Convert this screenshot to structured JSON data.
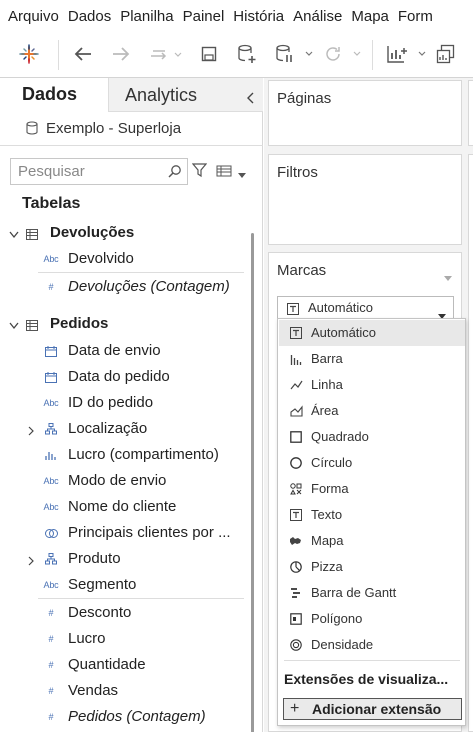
{
  "menu": [
    "Arquivo",
    "Dados",
    "Planilha",
    "Painel",
    "História",
    "Análise",
    "Mapa",
    "Form"
  ],
  "toolbar": {
    "icons": [
      "tableau-logo-icon",
      "back-icon",
      "forward-icon",
      "swap-icon",
      "save-icon",
      "new-datasource-icon",
      "pause-updates-icon",
      "refresh-icon",
      "new-worksheet-icon",
      "duplicate-icon"
    ]
  },
  "left": {
    "tab_data": "Dados",
    "tab_analytics": "Analytics",
    "datasource": "Exemplo - Superloja",
    "search_placeholder": "Pesquisar",
    "tables_title": "Tabelas",
    "tables": [
      {
        "name": "Devoluções",
        "fields": [
          {
            "label": "Devolvido",
            "type": "Abc"
          },
          {
            "label": "Devoluções (Contagem)",
            "type": "#"
          }
        ]
      },
      {
        "name": "Pedidos",
        "fields": [
          {
            "label": "Data de envio",
            "type": "date"
          },
          {
            "label": "Data do pedido",
            "type": "date"
          },
          {
            "label": "ID do pedido",
            "type": "Abc"
          },
          {
            "label": "Localização",
            "type": "hierarchy"
          },
          {
            "label": "Lucro (compartimento)",
            "type": "bin"
          },
          {
            "label": "Modo de envio",
            "type": "Abc"
          },
          {
            "label": "Nome do cliente",
            "type": "Abc"
          },
          {
            "label": "Principais clientes por ...",
            "type": "set"
          },
          {
            "label": "Produto",
            "type": "hierarchy"
          },
          {
            "label": "Segmento",
            "type": "Abc"
          },
          {
            "label": "Desconto",
            "type": "#"
          },
          {
            "label": "Lucro",
            "type": "#"
          },
          {
            "label": "Quantidade",
            "type": "#"
          },
          {
            "label": "Vendas",
            "type": "#"
          },
          {
            "label": "Pedidos (Contagem)",
            "type": "#"
          }
        ]
      }
    ]
  },
  "cards": {
    "pages": "Páginas",
    "filters": "Filtros",
    "marks": "Marcas",
    "marks_selected": "Automático"
  },
  "dropdown": {
    "items": [
      "Automático",
      "Barra",
      "Linha",
      "Área",
      "Quadrado",
      "Círculo",
      "Forma",
      "Texto",
      "Mapa",
      "Pizza",
      "Barra de Gantt",
      "Polígono",
      "Densidade"
    ],
    "extensions_title": "Extensões de visualiza...",
    "add_extension": "Adicionar extensão"
  },
  "colors": {
    "dimension": "#4a72b4",
    "measure": "#2f9e6d",
    "gutter": "#f3f3f3"
  }
}
